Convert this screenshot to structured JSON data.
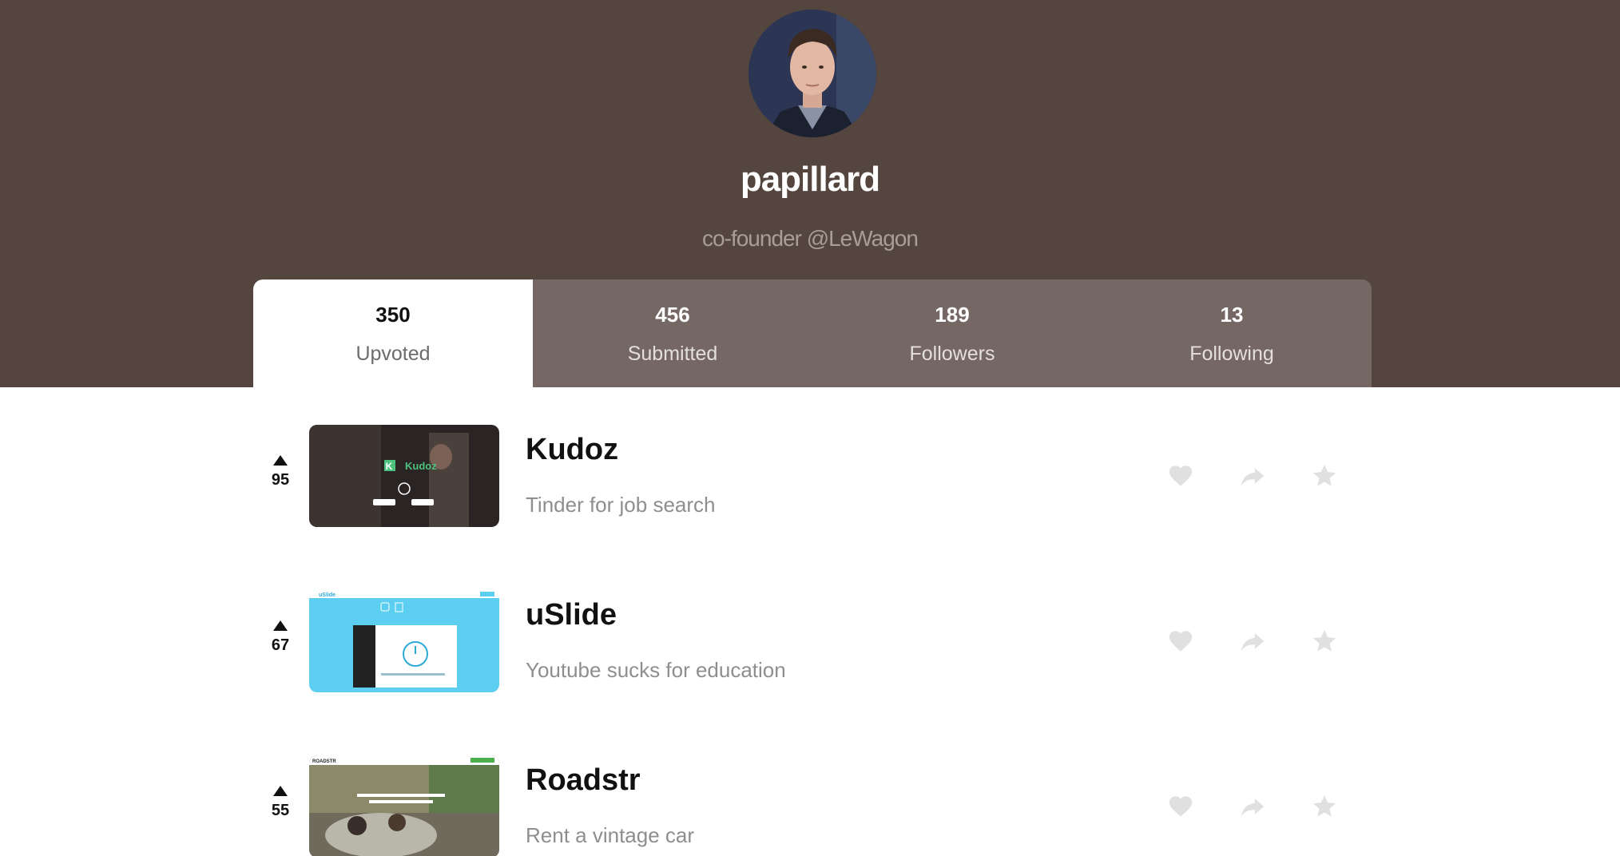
{
  "profile": {
    "username": "papillard",
    "tagline": "co-founder @LeWagon"
  },
  "tabs": [
    {
      "count": "350",
      "label": "Upvoted",
      "active": true
    },
    {
      "count": "456",
      "label": "Submitted",
      "active": false
    },
    {
      "count": "189",
      "label": "Followers",
      "active": false
    },
    {
      "count": "13",
      "label": "Following",
      "active": false
    }
  ],
  "products": [
    {
      "votes": "95",
      "name": "Kudoz",
      "description": "Tinder for job search",
      "thumb_text": "Kudoz"
    },
    {
      "votes": "67",
      "name": "uSlide",
      "description": "Youtube sucks for education",
      "thumb_text": "uSlide"
    },
    {
      "votes": "55",
      "name": "Roadstr",
      "description": "Rent a vintage car",
      "thumb_text": "ROADSTR"
    }
  ],
  "icons": {
    "like": "heart-icon",
    "share": "share-icon",
    "favorite": "star-icon"
  },
  "colors": {
    "banner": "#54453f",
    "tabs_bg": "#756864",
    "action_icon": "#e0e0e0"
  }
}
